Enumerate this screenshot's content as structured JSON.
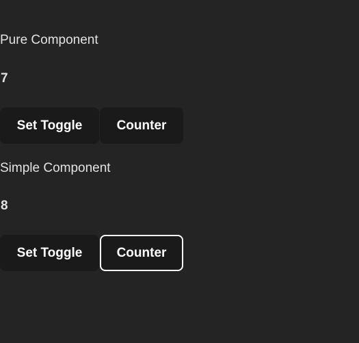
{
  "pure": {
    "title": "Pure Component",
    "count": "7",
    "toggle_label": "Set Toggle",
    "counter_label": "Counter"
  },
  "simple": {
    "title": "Simple Component",
    "count": "8",
    "toggle_label": "Set Toggle",
    "counter_label": "Counter"
  },
  "colors": {
    "background": "#242424",
    "button_bg": "#1a1a1a",
    "text": "#ffffff",
    "focus_outline": "#ffffff"
  }
}
